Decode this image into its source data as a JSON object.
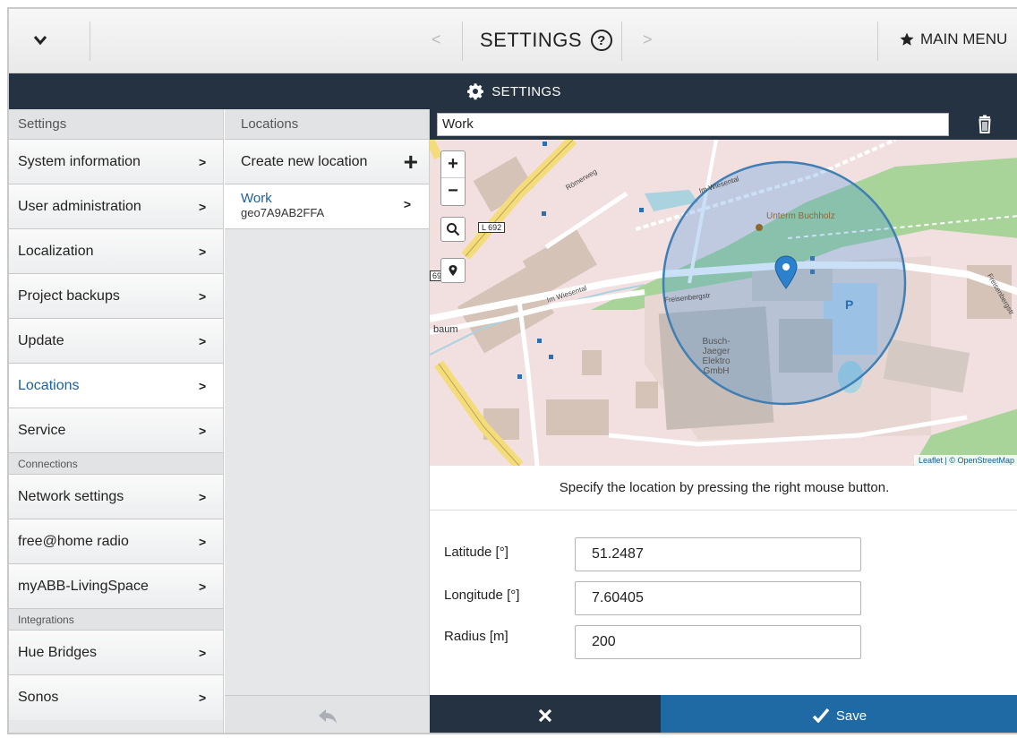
{
  "topbar": {
    "title": "SETTINGS",
    "help_symbol": "?",
    "prev_arrow": "<",
    "next_arrow": ">",
    "main_menu_label": "MAIN MENU"
  },
  "header": {
    "title": "SETTINGS"
  },
  "settings_column": {
    "heading": "Settings",
    "items": [
      {
        "label": "System information"
      },
      {
        "label": "User administration"
      },
      {
        "label": "Localization"
      },
      {
        "label": "Project backups"
      },
      {
        "label": "Update"
      },
      {
        "label": "Locations",
        "active": true
      },
      {
        "label": "Service"
      }
    ],
    "connections_label": "Connections",
    "connections": [
      {
        "label": "Network settings"
      },
      {
        "label": "free@home radio"
      },
      {
        "label": "myABB-LivingSpace"
      }
    ],
    "integrations_label": "Integrations",
    "integrations": [
      {
        "label": "Hue Bridges"
      },
      {
        "label": "Sonos"
      }
    ]
  },
  "locations_column": {
    "heading": "Locations",
    "create_label": "Create new location",
    "items": [
      {
        "name": "Work",
        "id": "geo7A9AB2FFA"
      }
    ]
  },
  "detail": {
    "name_value": "Work",
    "map": {
      "attribution": "Leaflet | © OpenStreetMap",
      "labels": {
        "area": "Unterm Buchholz",
        "company_1": "Busch-",
        "company_2": "Jaeger",
        "company_3": "Elektro",
        "company_4": "GmbH",
        "parking": "P",
        "road_l692": "L 692",
        "road_69": "69",
        "road_baum": "baum",
        "street_1": "Im Wiesental",
        "street_2": "Freisenbergstr",
        "street_3": "Römerweg",
        "street_4": "Im Wiesental",
        "street_5": "Freisenbergstr"
      }
    },
    "hint": "Specify the location by pressing the right mouse button.",
    "fields": {
      "latitude_label": "Latitude [°]",
      "latitude_value": "51.2487",
      "longitude_label": "Longitude [°]",
      "longitude_value": "7.60405",
      "radius_label": "Radius [m]",
      "radius_value": "200"
    },
    "save_label": "Save"
  },
  "colors": {
    "dark_header": "#253241",
    "accent_blue": "#1f6aa5",
    "active_text": "#1f5f9e"
  }
}
